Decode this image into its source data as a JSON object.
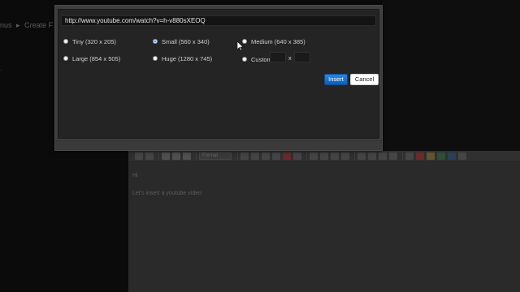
{
  "background": {
    "breadcrumb": [
      "nus",
      "Create F"
    ],
    "breadcrumb_separator": "▸",
    "side_mark": "-"
  },
  "modal": {
    "url_value": "http://www.youtube.com/watch?v=h-v880sXEOQ",
    "size_options": [
      {
        "label": "Tiny (320 x 205)",
        "checked": false
      },
      {
        "label": "Small (560 x 340)",
        "checked": true
      },
      {
        "label": "Medium (640 x 385)",
        "checked": false
      },
      {
        "label": "Large (854 x 505)",
        "checked": false
      },
      {
        "label": "Huge (1280 x 745)",
        "checked": false
      },
      {
        "label": "Custom",
        "checked": false
      }
    ],
    "custom_separator": "x",
    "insert_label": "Insert",
    "cancel_label": "Cancel",
    "colors": {
      "accent": "#1a73d6",
      "dialog_bg": "#242424"
    }
  },
  "editor": {
    "toolbar_select_label": "Format",
    "body_lines": [
      "Hi",
      "Let's insert a youtube video"
    ]
  }
}
